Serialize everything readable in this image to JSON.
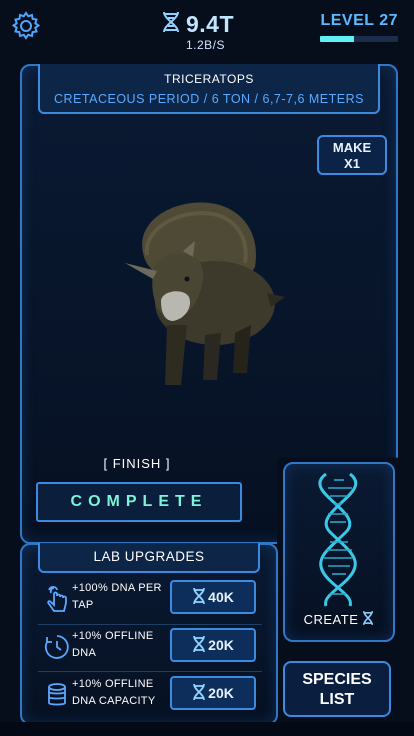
{
  "header": {
    "dna_total": "9.4T",
    "dna_rate": "1.2B/S",
    "level_label": "LEVEL 27",
    "level_progress": 0.44
  },
  "species": {
    "name": "TRICERATOPS",
    "info": "CRETACEOUS PERIOD / 6 TON / 6,7-7,6 METERS",
    "make_line1": "MAKE",
    "make_line2": "X1",
    "status": "[ FINISH ]",
    "complete_label": "COMPLETE"
  },
  "lab": {
    "title": "LAB UPGRADES",
    "upgrades": [
      {
        "line1": "+100% DNA PER",
        "line2": "TAP",
        "cost": "40K",
        "icon": "tap-hand-icon"
      },
      {
        "line1": "+10% OFFLINE",
        "line2": "DNA",
        "cost": "20K",
        "icon": "offline-clock-icon"
      },
      {
        "line1": "+10% OFFLINE",
        "line2": "DNA CAPACITY",
        "cost": "20K",
        "icon": "dna-capacity-icon"
      }
    ]
  },
  "create": {
    "label": "CREATE"
  },
  "species_list": {
    "line1": "SPECIES",
    "line2": "LIST"
  },
  "colors": {
    "accent": "#3b8be2",
    "cyan": "#5ef0f4",
    "complete_text": "#7df3d8",
    "background": "#060d1b"
  }
}
